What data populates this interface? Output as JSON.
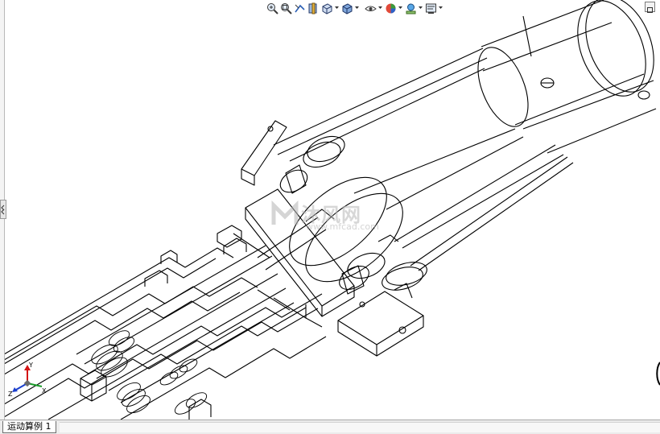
{
  "toolbar": {
    "icons": [
      "zoom-to-fit-icon",
      "zoom-area-icon",
      "previous-view-icon",
      "section-view-icon",
      "view-orientation-icon",
      "display-style-icon",
      "hide-show-items-icon",
      "edit-appearance-icon",
      "apply-scene-icon",
      "view-settings-icon"
    ]
  },
  "watermark": {
    "text_cn": "沐风网",
    "url": "www.mfcad.com"
  },
  "triad": {
    "x_label": "X",
    "y_label": "Y",
    "z_label": "Z"
  },
  "bottom_tabs": [
    {
      "label": "运动算例 1"
    }
  ],
  "colors": {
    "line": "#000000",
    "triad_x": "#d41414",
    "triad_y": "#1b9c2a",
    "triad_z": "#1b3fcc"
  }
}
